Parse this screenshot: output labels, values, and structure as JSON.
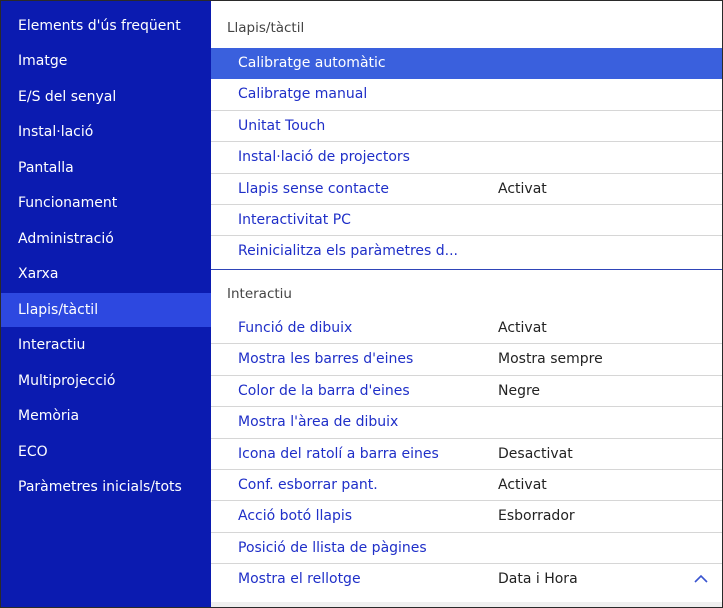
{
  "sidebar": {
    "items": [
      {
        "label": "Elements d'ús freqüent",
        "active": false
      },
      {
        "label": "Imatge",
        "active": false
      },
      {
        "label": "E/S del senyal",
        "active": false
      },
      {
        "label": "Instal·lació",
        "active": false
      },
      {
        "label": "Pantalla",
        "active": false
      },
      {
        "label": "Funcionament",
        "active": false
      },
      {
        "label": "Administració",
        "active": false
      },
      {
        "label": "Xarxa",
        "active": false
      },
      {
        "label": "Llapis/tàctil",
        "active": true
      },
      {
        "label": "Interactiu",
        "active": false
      },
      {
        "label": "Multiprojecció",
        "active": false
      },
      {
        "label": "Memòria",
        "active": false
      },
      {
        "label": "ECO",
        "active": false
      },
      {
        "label": "Paràmetres inicials/tots",
        "active": false
      }
    ]
  },
  "main": {
    "sections": [
      {
        "header": "Llapis/tàctil",
        "rows": [
          {
            "label": "Calibratge automàtic",
            "value": "",
            "selected": true
          },
          {
            "label": "Calibratge manual",
            "value": ""
          },
          {
            "label": "Unitat Touch",
            "value": ""
          },
          {
            "label": "Instal·lació de projectors",
            "value": ""
          },
          {
            "label": "Llapis sense contacte",
            "value": "Activat"
          },
          {
            "label": "Interactivitat PC",
            "value": ""
          },
          {
            "label": "Reinicialitza els paràmetres d...",
            "value": ""
          }
        ]
      },
      {
        "header": "Interactiu",
        "rows": [
          {
            "label": "Funció de dibuix",
            "value": "Activat"
          },
          {
            "label": "Mostra les barres d'eines",
            "value": "Mostra sempre"
          },
          {
            "label": "Color de la barra d'eines",
            "value": "Negre"
          },
          {
            "label": "Mostra l'àrea de dibuix",
            "value": ""
          },
          {
            "label": "Icona del ratolí a barra eines",
            "value": "Desactivat"
          },
          {
            "label": "Conf. esborrar pant.",
            "value": "Activat"
          },
          {
            "label": "Acció botó llapis",
            "value": "Esborrador"
          },
          {
            "label": "Posició de llista de pàgines",
            "value": ""
          },
          {
            "label": "Mostra el rellotge",
            "value": "Data i Hora"
          }
        ]
      }
    ]
  },
  "icons": {
    "scroll_up": "chevron-up-icon"
  },
  "colors": {
    "sidebar_bg": "#0b1bb0",
    "sidebar_active": "#2d48e0",
    "selected_row": "#3a60dd",
    "item_text": "#1f2fc8"
  }
}
